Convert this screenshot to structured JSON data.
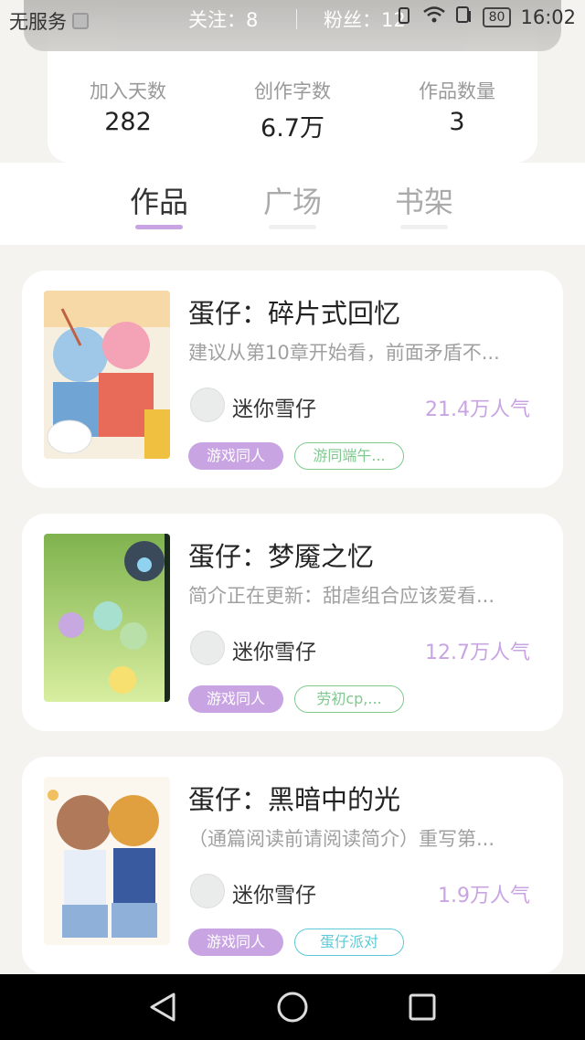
{
  "status_bar": {
    "carrier": "无服务",
    "time": "16:02",
    "battery": "80"
  },
  "header": {
    "follow": "关注：8",
    "fans": "粉丝：12"
  },
  "stats": [
    {
      "label": "加入天数",
      "value": "282"
    },
    {
      "label": "创作字数",
      "value": "6.7万"
    },
    {
      "label": "作品数量",
      "value": "3"
    }
  ],
  "tabs": [
    {
      "label": "作品",
      "active": true
    },
    {
      "label": "广场",
      "active": false
    },
    {
      "label": "书架",
      "active": false
    }
  ],
  "works": [
    {
      "title": "蛋仔：碎片式回忆",
      "desc": "建议从第10章开始看，前面矛盾不...",
      "author": "迷你雪仔",
      "popularity": "21.4万人气",
      "tag1": "游戏同人",
      "tag2": "游同端午...",
      "tag2_color": "#7fc98f"
    },
    {
      "title": "蛋仔：梦魇之忆",
      "desc": "简介正在更新：甜虐组合应该爱看...",
      "author": "迷你雪仔",
      "popularity": "12.7万人气",
      "tag1": "游戏同人",
      "tag2": "劳初cp,...",
      "tag2_color": "#7fc98f"
    },
    {
      "title": "蛋仔：黑暗中的光",
      "desc": "（通篇阅读前请阅读简介）重写第...",
      "author": "迷你雪仔",
      "popularity": "1.9万人气",
      "tag1": "游戏同人",
      "tag2": "蛋仔派对",
      "tag2_color": "#5cc9d6"
    }
  ],
  "colors": {
    "accent": "#c9a4e3",
    "tab_underline": "#c9a4e3"
  }
}
